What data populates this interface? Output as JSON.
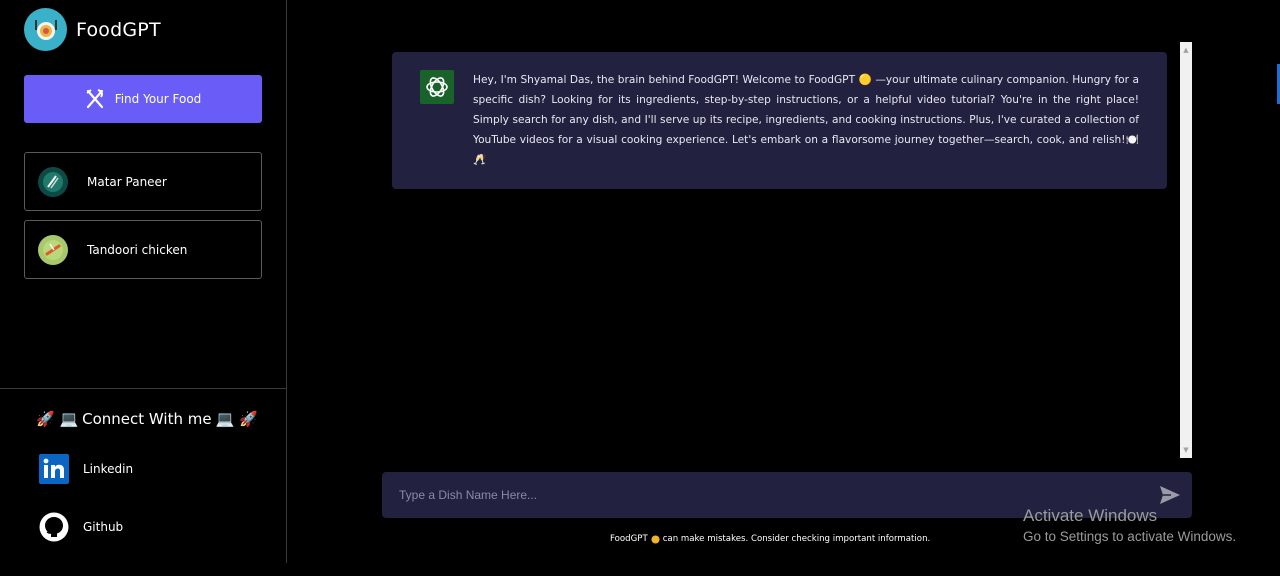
{
  "app": {
    "title": "FoodGPT"
  },
  "sidebar": {
    "find_button_label": "Find Your Food",
    "history": [
      {
        "label": "Matar Paneer",
        "icon": "dish-icon"
      },
      {
        "label": "Tandoori chicken",
        "icon": "dish-icon"
      }
    ],
    "connect_title": "Connect With me",
    "connect_emoji_left": "🚀 💻",
    "connect_emoji_right": "💻 🚀",
    "socials": [
      {
        "label": "Linkedin",
        "icon": "linkedin-icon"
      },
      {
        "label": "Github",
        "icon": "github-icon"
      }
    ]
  },
  "chat": {
    "message": "Hey, I'm Shyamal Das, the brain behind FoodGPT! Welcome to FoodGPT 🟡 —your ultimate culinary companion. Hungry for a specific dish? Looking for its ingredients, step-by-step instructions, or a helpful video tutorial? You're in the right place! Simply search for any dish, and I'll serve up its recipe, ingredients, and cooking instructions. Plus, I've curated a collection of YouTube videos for a visual cooking experience. Let's embark on a flavorsome journey together—search, cook, and relish!🍽️🥂"
  },
  "input": {
    "placeholder": "Type a Dish Name Here..."
  },
  "footer": {
    "disclaimer_brand": "FoodGPT",
    "disclaimer_text": "can make mistakes. Consider checking important information."
  },
  "os_overlay": {
    "line1": "Activate Windows",
    "line2": "Go to Settings to activate Windows."
  },
  "colors": {
    "accent": "#6a5cf6",
    "bubble": "#222240",
    "brand_logo": "#3bb0c9",
    "bot_avatar": "#19632b"
  }
}
